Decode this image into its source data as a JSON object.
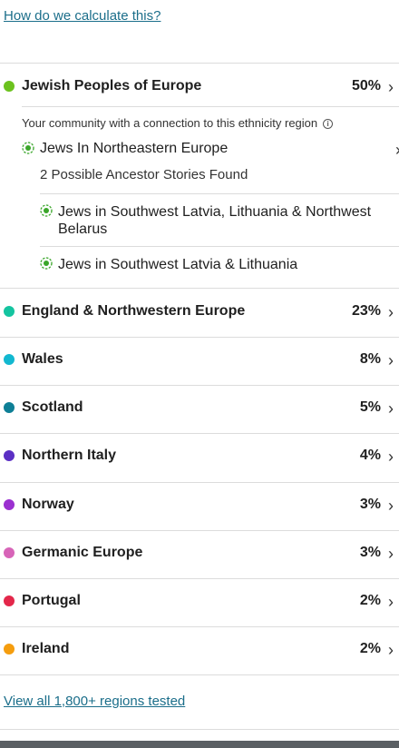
{
  "calc_link": "How do we calculate this?",
  "primary_region": {
    "name": "Jewish Peoples of Europe",
    "percent": "50%",
    "color": "#6cc21e"
  },
  "community": {
    "intro": "Your community with a connection to this ethnicity region",
    "title": "Jews In Northeastern Europe",
    "stories_found": "2 Possible Ancestor Stories Found",
    "stories": [
      "Jews in Southwest Latvia, Lithuania & Northwest Belarus",
      "Jews in Southwest Latvia & Lithuania"
    ],
    "icon_color": "#3aa62a"
  },
  "regions": [
    {
      "name": "England & Northwestern Europe",
      "percent": "23%",
      "color": "#14c4a0"
    },
    {
      "name": "Wales",
      "percent": "8%",
      "color": "#12b8d0"
    },
    {
      "name": "Scotland",
      "percent": "5%",
      "color": "#0e7f96"
    },
    {
      "name": "Northern Italy",
      "percent": "4%",
      "color": "#5b2fc4"
    },
    {
      "name": "Norway",
      "percent": "3%",
      "color": "#9b30d0"
    },
    {
      "name": "Germanic Europe",
      "percent": "3%",
      "color": "#d764b8"
    },
    {
      "name": "Portugal",
      "percent": "2%",
      "color": "#e3274a"
    },
    {
      "name": "Ireland",
      "percent": "2%",
      "color": "#f59d0e"
    }
  ],
  "view_all": "View all 1,800+ regions tested",
  "icons": {
    "chevron": "chevron-right-icon",
    "info": "info-icon",
    "community": "community-icon"
  }
}
